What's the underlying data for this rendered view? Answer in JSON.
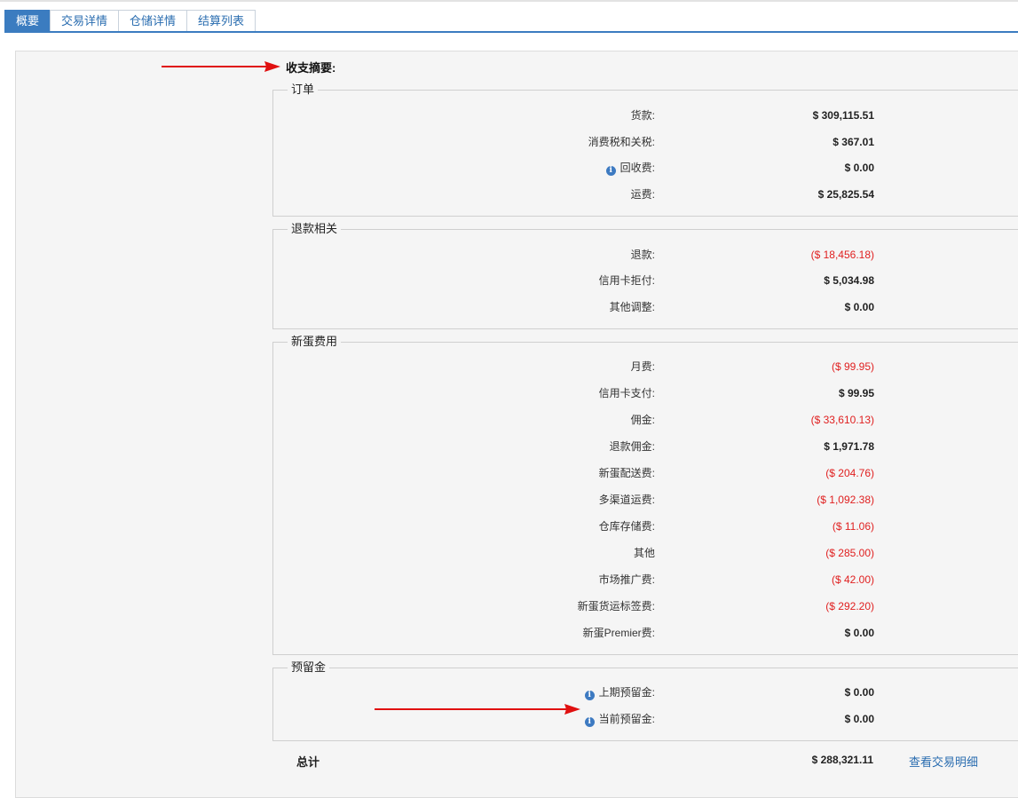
{
  "tabs": [
    {
      "label": "概要",
      "active": true
    },
    {
      "label": "交易详情",
      "active": false
    },
    {
      "label": "仓储详情",
      "active": false
    },
    {
      "label": "结算列表",
      "active": false
    }
  ],
  "summary_title": "收支摘要:",
  "groups": {
    "orders": {
      "title": "订单",
      "rows": [
        {
          "label": "货款:",
          "value": "$ 309,115.51"
        },
        {
          "label": "消费税和关税:",
          "value": "$ 367.01"
        },
        {
          "label": "回收费:",
          "value": "$ 0.00"
        },
        {
          "label": "运费:",
          "value": "$ 25,825.54"
        }
      ]
    },
    "refunds": {
      "title": "退款相关",
      "rows": [
        {
          "label": "退款:",
          "value": "($ 18,456.18)"
        },
        {
          "label": "信用卡拒付:",
          "value": "$ 5,034.98"
        },
        {
          "label": "其他调整:",
          "value": "$ 0.00"
        }
      ]
    },
    "newegg_fees": {
      "title": "新蛋费用",
      "rows": [
        {
          "label": "月费:",
          "value": "($ 99.95)"
        },
        {
          "label": "信用卡支付:",
          "value": "$ 99.95"
        },
        {
          "label": "佣金:",
          "value": "($ 33,610.13)"
        },
        {
          "label": "退款佣金:",
          "value": "$ 1,971.78"
        },
        {
          "label": "新蛋配送费:",
          "value": "($ 204.76)"
        },
        {
          "label": "多渠道运费:",
          "value": "($ 1,092.38)"
        },
        {
          "label": "仓库存储费:",
          "value": "($ 11.06)"
        },
        {
          "label": "其他",
          "value": "($ 285.00)"
        },
        {
          "label": "市场推广费:",
          "value": "($ 42.00)"
        },
        {
          "label": "新蛋货运标签费:",
          "value": "($ 292.20)"
        },
        {
          "label": "新蛋Premier费:",
          "value": "$ 0.00"
        }
      ]
    },
    "reserve": {
      "title": "预留金",
      "rows": [
        {
          "label": "上期预留金:",
          "value": "$ 0.00"
        },
        {
          "label": "当前预留金:",
          "value": "$ 0.00"
        }
      ]
    }
  },
  "total": {
    "label": "总计",
    "value": "$ 288,321.11",
    "link": "查看交易明细"
  },
  "colors": {
    "accent": "#3b7cc0",
    "negative": "#e02020",
    "arrow": "#e01010",
    "info_icon": "#3d7ac1"
  },
  "icons": [
    "info-icon"
  ]
}
